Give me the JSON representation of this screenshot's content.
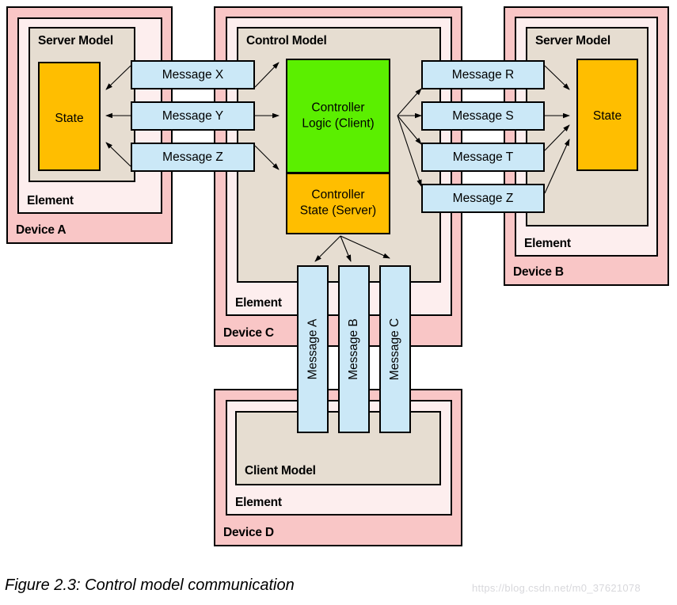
{
  "figure": {
    "caption": "Figure 2.3: Control model communication",
    "watermark": "https://blog.csdn.net/m0_37621078"
  },
  "colors": {
    "device_fill": "#f9c6c6",
    "element_fill": "#fdeeee",
    "model_fill": "#e6ddd1",
    "state_fill": "#ffbe00",
    "logic_fill": "#5bef00",
    "message_fill": "#cbe8f7",
    "stroke": "#000000",
    "caption_text": "#000000",
    "watermark_text": "#d8d8dc"
  },
  "devices": {
    "a": {
      "device_label": "Device A",
      "element_label": "Element",
      "model_label": "Server Model",
      "state_label": "State"
    },
    "b": {
      "device_label": "Device B",
      "element_label": "Element",
      "model_label": "Server Model",
      "state_label": "State"
    },
    "c": {
      "device_label": "Device C",
      "element_label": "Element",
      "model_label": "Control Model",
      "logic_label_line1": "Controller",
      "logic_label_line2": "Logic (Client)",
      "state_label_line1": "Controller",
      "state_label_line2": "State (Server)"
    },
    "d": {
      "device_label": "Device D",
      "element_label": "Element",
      "model_label": "Client Model"
    }
  },
  "messages": {
    "left": [
      {
        "label": "Message X"
      },
      {
        "label": "Message Y"
      },
      {
        "label": "Message Z"
      }
    ],
    "right": [
      {
        "label": "Message R"
      },
      {
        "label": "Message S"
      },
      {
        "label": "Message T"
      },
      {
        "label": "Message Z"
      }
    ],
    "bottom": [
      {
        "label": "Message A"
      },
      {
        "label": "Message B"
      },
      {
        "label": "Message C"
      }
    ]
  }
}
